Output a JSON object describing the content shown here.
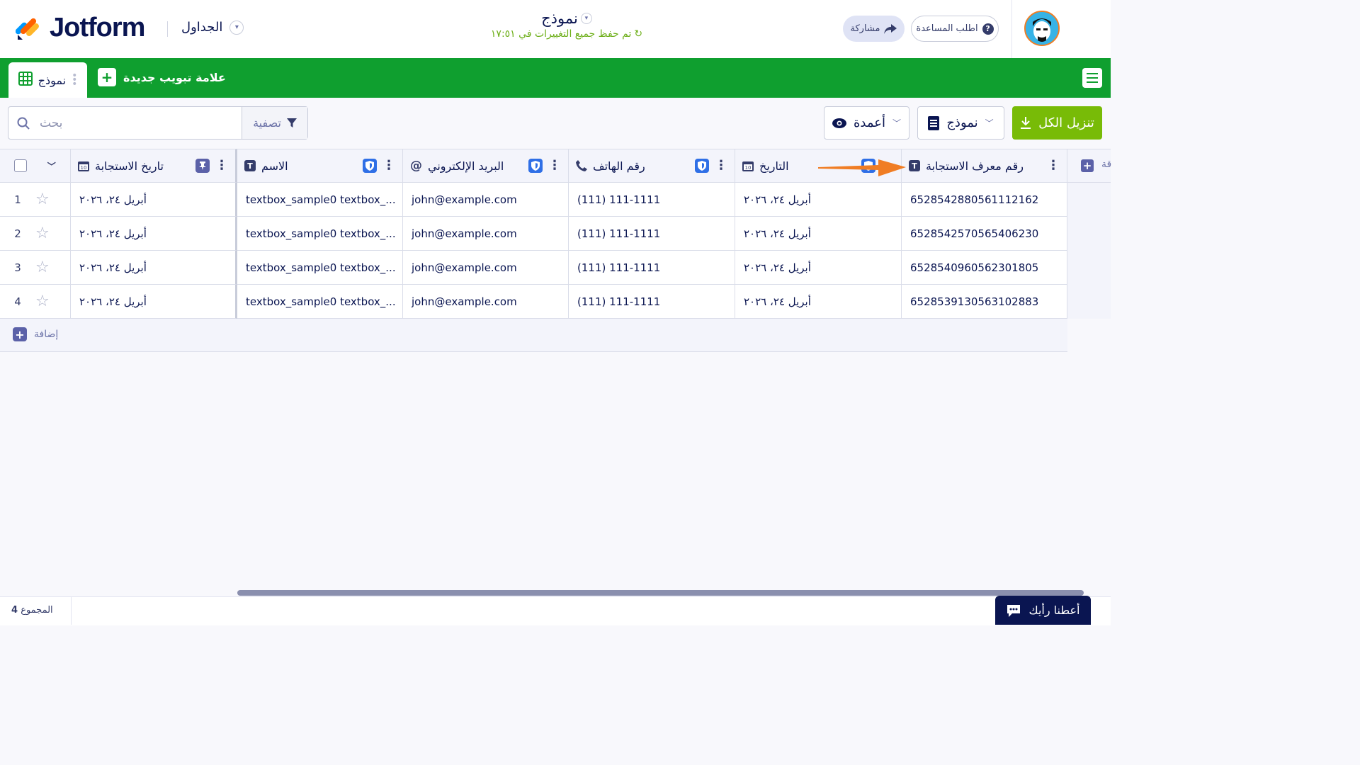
{
  "header": {
    "logo_text": "Jotform",
    "tables_label": "الجداول",
    "form_title": "نموذج",
    "saved_status": "تم حفظ جميع التغييرات في ١٧:٥١",
    "share_label": "مشاركة",
    "help_label": "اطلب المساعدة"
  },
  "tabs": {
    "active_label": "نموذج",
    "new_tab_label": "علامة تبويب جديدة"
  },
  "toolbar": {
    "search_placeholder": "بحث",
    "filter_label": "تصفية",
    "columns_label": "أعمدة",
    "form_select_label": "نموذج",
    "download_all_label": "تنزيل الكل"
  },
  "table": {
    "columns": [
      {
        "label": "تاريخ الاستجابة",
        "icon": "calendar-icon"
      },
      {
        "label": "الاسم",
        "icon": "text-icon"
      },
      {
        "label": "البريد الإلكتروني",
        "icon": "at-icon"
      },
      {
        "label": "رقم الهاتف",
        "icon": "phone-icon"
      },
      {
        "label": "التاريخ",
        "icon": "calendar-icon"
      },
      {
        "label": "رقم معرف الاستجابة",
        "icon": "text-icon"
      }
    ],
    "add_column_label": "قة",
    "rows": [
      {
        "num": "1",
        "cells": [
          "أبريل ٢٤، ٢٠٢٦",
          "textbox_sample0 textbox_...",
          "john@example.com",
          "(111) 111-1111",
          "أبريل ٢٤، ٢٠٢٦",
          "6528542880561112162"
        ]
      },
      {
        "num": "2",
        "cells": [
          "أبريل ٢٤، ٢٠٢٦",
          "textbox_sample0 textbox_...",
          "john@example.com",
          "(111) 111-1111",
          "أبريل ٢٤، ٢٠٢٦",
          "6528542570565406230"
        ]
      },
      {
        "num": "3",
        "cells": [
          "أبريل ٢٤، ٢٠٢٦",
          "textbox_sample0 textbox_...",
          "john@example.com",
          "(111) 111-1111",
          "أبريل ٢٤، ٢٠٢٦",
          "6528540960562301805"
        ]
      },
      {
        "num": "4",
        "cells": [
          "أبريل ٢٤، ٢٠٢٦",
          "textbox_sample0 textbox_...",
          "john@example.com",
          "(111) 111-1111",
          "أبريل ٢٤، ٢٠٢٦",
          "6528539130563102883"
        ]
      }
    ],
    "add_row_label": "إضافة"
  },
  "footer": {
    "total_label": "المجموع",
    "total_count": "4",
    "feedback_label": "أعطنا رأيك"
  },
  "colors": {
    "brand_green": "#0f9f2f",
    "download_green": "#78bb07",
    "navy": "#0a1551",
    "arrow_orange": "#f07d24"
  }
}
